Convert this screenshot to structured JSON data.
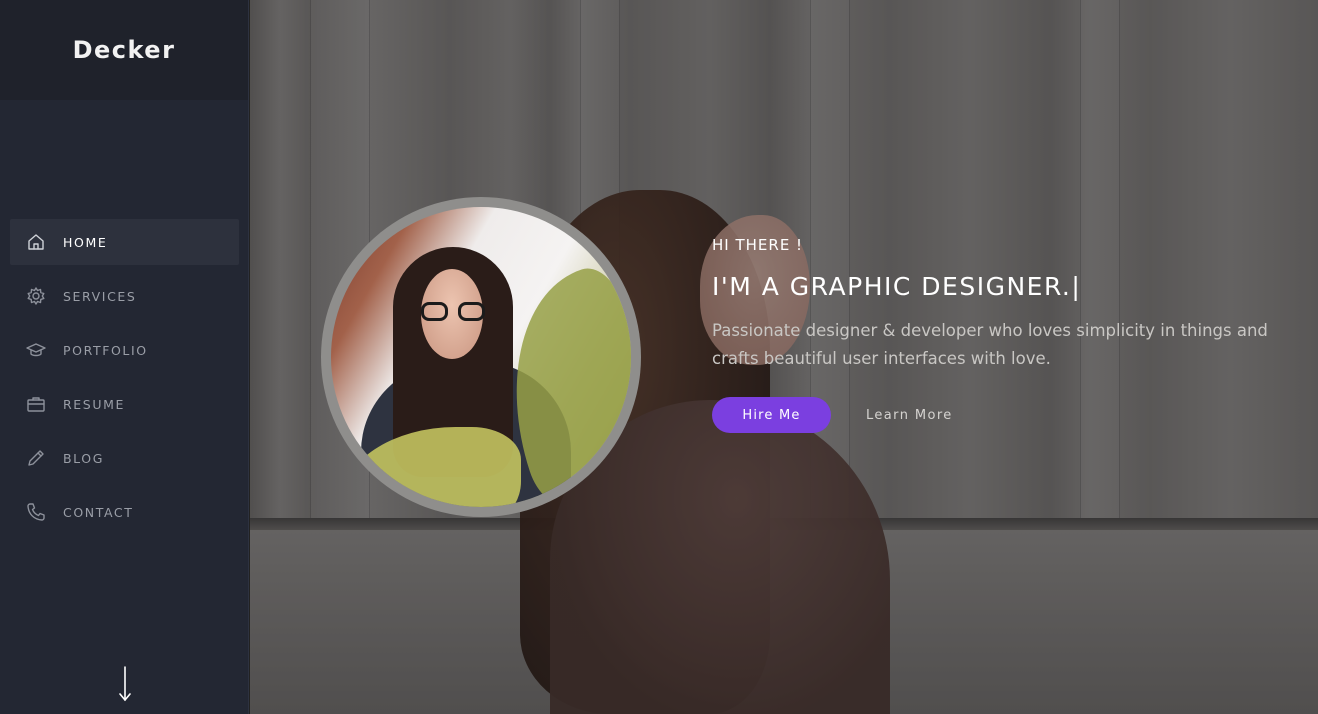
{
  "brand": {
    "name": "Decker"
  },
  "nav": {
    "items": [
      {
        "label": "HOME",
        "icon": "home-icon",
        "active": true
      },
      {
        "label": "SERVICES",
        "icon": "gear-icon",
        "active": false
      },
      {
        "label": "PORTFOLIO",
        "icon": "graduation-cap-icon",
        "active": false
      },
      {
        "label": "RESUME",
        "icon": "briefcase-icon",
        "active": false
      },
      {
        "label": "BLOG",
        "icon": "pencil-icon",
        "active": false
      },
      {
        "label": "CONTACT",
        "icon": "phone-icon",
        "active": false
      }
    ],
    "scroll_icon": "arrow-down-icon"
  },
  "hero": {
    "greeting": "HI THERE !",
    "headline": "I'M A GRAPHIC DESIGNER.",
    "cursor": "|",
    "description": "Passionate designer & developer who loves simplicity in things and crafts beautiful user interfaces with love.",
    "primary_button": "Hire Me",
    "secondary_button": "Learn More"
  },
  "colors": {
    "sidebar": "#232733",
    "accent": "#7b3fe0",
    "active_item": "#2d313d"
  }
}
